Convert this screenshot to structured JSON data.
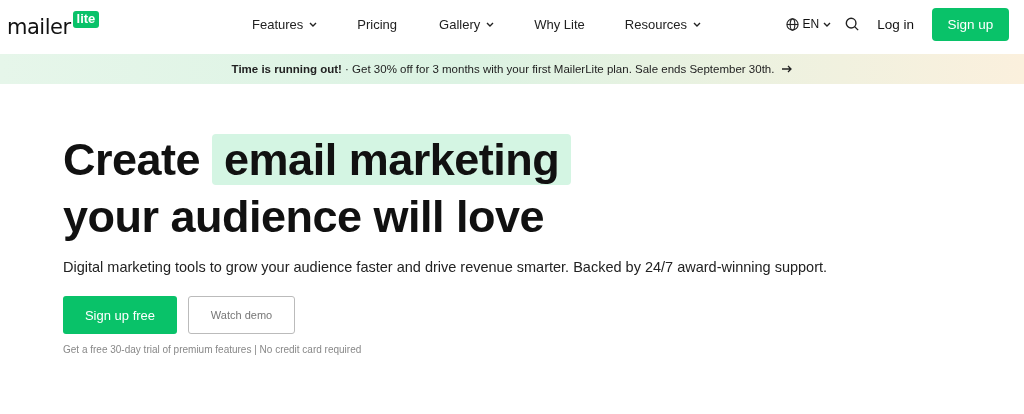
{
  "logo": {
    "word": "mailer",
    "badge": "lite"
  },
  "nav": [
    {
      "label": "Features",
      "dropdown": true
    },
    {
      "label": "Pricing",
      "dropdown": false
    },
    {
      "label": "Gallery",
      "dropdown": true
    },
    {
      "label": "Why Lite",
      "dropdown": false
    },
    {
      "label": "Resources",
      "dropdown": true
    }
  ],
  "language": "EN",
  "login": "Log in",
  "signup": "Sign up",
  "banner": "**Time is running out!** · Get 30% off for 3 months with your first MailerLite plan. Sale ends September 30th.",
  "headline": {
    "before": "Create",
    "highlight": "email marketing",
    "after": "your audience will love"
  },
  "subtitle": "Digital marketing tools to grow your audience faster and drive revenue smarter. Backed by 24/7 award-winning support.",
  "primary_button": "Sign up free",
  "secondary_button": "Watch demo",
  "footnote": "Get a free 30-day trial of premium features | No credit card required"
}
